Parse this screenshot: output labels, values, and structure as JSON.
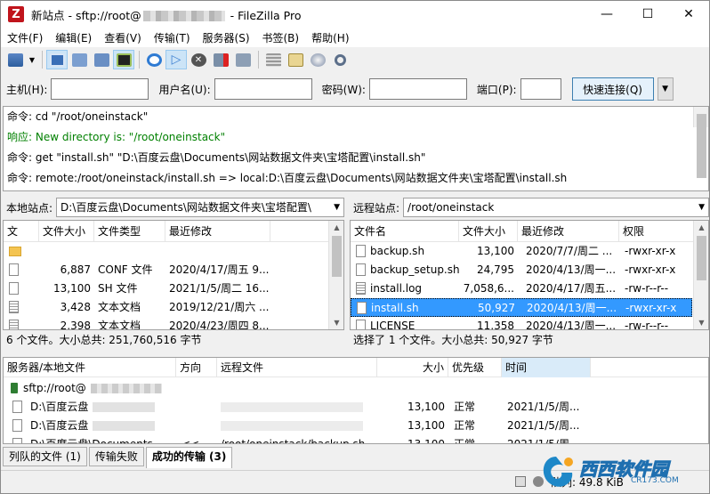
{
  "window": {
    "title_prefix": "新站点 - sftp://root@",
    "title_suffix": " - FileZilla Pro",
    "app_icon": "Z",
    "controls": {
      "minimize": "—",
      "maximize": "☐",
      "close": "✕"
    }
  },
  "menu": [
    "文件(F)",
    "编辑(E)",
    "查看(V)",
    "传输(T)",
    "服务器(S)",
    "书签(B)",
    "帮助(H)"
  ],
  "quickconnect": {
    "host_label": "主机(H):",
    "user_label": "用户名(U):",
    "pass_label": "密码(W):",
    "port_label": "端口(P):",
    "button": "快速连接(Q)",
    "dropdown": "▼",
    "host": "",
    "user": "",
    "pass": "",
    "port": ""
  },
  "log": [
    {
      "label": "命令:",
      "text": "cd \"/root/oneinstack\"",
      "type": "cmd"
    },
    {
      "label": "响应:",
      "text": "New directory is: \"/root/oneinstack\"",
      "type": "resp"
    },
    {
      "label": "命令:",
      "text": "get \"install.sh\" \"D:\\百度云盘\\Documents\\网站数据文件夹\\宝塔配置\\install.sh\"",
      "type": "cmd"
    },
    {
      "label": "命令:",
      "text": "remote:/root/oneinstack/install.sh => local:D:\\百度云盘\\Documents\\网站数据文件夹\\宝塔配置\\install.sh",
      "type": "cmd"
    }
  ],
  "local": {
    "site_label": "本地站点:",
    "path": "D:\\百度云盘\\Documents\\网站数据文件夹\\宝塔配置\\",
    "columns": [
      "文",
      "文件大小",
      "文件类型",
      "最近修改"
    ],
    "rows": [
      {
        "name": "",
        "size": "",
        "type": "",
        "modified": "",
        "icon": "folder"
      },
      {
        "name": "",
        "size": "6,887",
        "type": "CONF 文件",
        "modified": "2020/4/17/周五 9...",
        "icon": "file"
      },
      {
        "name": "",
        "size": "13,100",
        "type": "SH 文件",
        "modified": "2021/1/5/周二 16...",
        "icon": "file"
      },
      {
        "name": "",
        "size": "3,428",
        "type": "文本文档",
        "modified": "2019/12/21/周六 ...",
        "icon": "text"
      },
      {
        "name": "",
        "size": "2,398",
        "type": "文本文档",
        "modified": "2020/4/23/周四 8...",
        "icon": "text"
      }
    ],
    "status": "6 个文件。大小总共: 251,760,516 字节"
  },
  "remote": {
    "site_label": "远程站点:",
    "path": "/root/oneinstack",
    "columns": [
      "文件名",
      "文件大小",
      "最近修改",
      "权限"
    ],
    "rows": [
      {
        "name": "backup.sh",
        "size": "13,100",
        "modified": "2020/7/7/周二 ...",
        "perm": "-rwxr-xr-x",
        "selected": false
      },
      {
        "name": "backup_setup.sh",
        "size": "24,795",
        "modified": "2020/4/13/周一...",
        "perm": "-rwxr-xr-x",
        "selected": false
      },
      {
        "name": "install.log",
        "size": "7,058,6...",
        "modified": "2020/4/17/周五...",
        "perm": "-rw-r--r--",
        "selected": false
      },
      {
        "name": "install.sh",
        "size": "50,927",
        "modified": "2020/4/13/周一...",
        "perm": "-rwxr-xr-x",
        "selected": true
      },
      {
        "name": "LICENSE",
        "size": "11,358",
        "modified": "2020/4/13/周一...",
        "perm": "-rw-r--r--",
        "selected": false
      }
    ],
    "status": "选择了 1 个文件。大小总共: 50,927 字节"
  },
  "queue": {
    "columns": [
      "服务器/本地文件",
      "方向",
      "远程文件",
      "大小",
      "优先级",
      "时间"
    ],
    "server": "sftp://root@",
    "rows": [
      {
        "local": "D:\\百度云盘",
        "dir": "",
        "remote": "",
        "size": "13,100",
        "priority": "正常",
        "time": "2021/1/5/周..."
      },
      {
        "local": "D:\\百度云盘",
        "dir": "",
        "remote": "",
        "size": "13,100",
        "priority": "正常",
        "time": "2021/1/5/周..."
      },
      {
        "local": "D:\\百度云盘\\Documents",
        "dir": "<<",
        "remote": "/root/oneinstack/backup.sh",
        "size": "13,100",
        "priority": "正常",
        "time": "2021/1/5/周..."
      }
    ]
  },
  "tabs": [
    "列队的文件 (1)",
    "传输失败",
    "成功的传输 (3)"
  ],
  "statusbar": {
    "queue_text": "队列: 49.8 KiB",
    "watermark": "西西软件园",
    "watermark_sub": "CR173.COM"
  }
}
